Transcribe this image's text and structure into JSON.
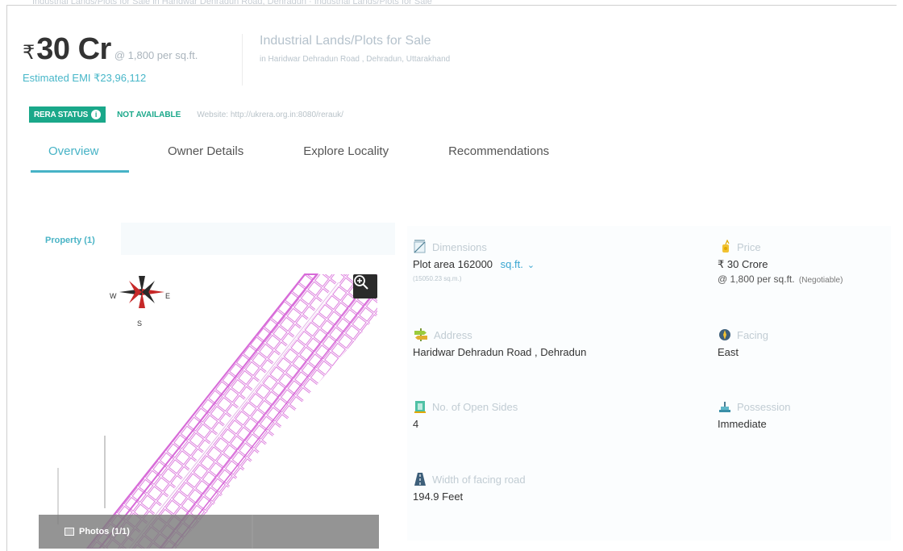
{
  "header": {
    "top_text": "Industrial Lands/Plots for Sale in Haridwar Dehradun Road, Dehradun · Industrial Lands/Plots for Sale",
    "price_symbol": "₹",
    "price": "30 Cr",
    "price_per_sqft": "@ 1,800 per sq.ft.",
    "emi": "Estimated EMI ₹23,96,112",
    "title": "Industrial Lands/Plots for Sale",
    "subtitle": "in Haridwar Dehradun Road , Dehradun, Uttarakhand"
  },
  "rera": {
    "badge": "RERA STATUS",
    "status": "NOT AVAILABLE",
    "website": "Website: http://ukrera.org.in:8080/rerauk/"
  },
  "tabs": [
    {
      "label": "Overview",
      "active": true
    },
    {
      "label": "Owner Details",
      "active": false
    },
    {
      "label": "Explore Locality",
      "active": false
    },
    {
      "label": "Recommendations",
      "active": false
    }
  ],
  "gallery": {
    "property_label": "Property (1)",
    "photos_label": "Photos (1/1)",
    "compass": {
      "w": "W",
      "e": "E",
      "s": "S"
    }
  },
  "details": {
    "dimensions": {
      "label": "Dimensions",
      "value": "Plot area 162000",
      "unit": "sq.ft.",
      "sub": "(15050.23 sq.m.)"
    },
    "price": {
      "label": "Price",
      "value": "₹ 30 Crore",
      "line2": "@ 1,800 per sq.ft.",
      "negotiable": "(Negotiable)"
    },
    "address": {
      "label": "Address",
      "value": "Haridwar Dehradun Road , Dehradun"
    },
    "facing": {
      "label": "Facing",
      "value": "East"
    },
    "open_sides": {
      "label": "No. of Open Sides",
      "value": "4"
    },
    "possession": {
      "label": "Possession",
      "value": "Immediate"
    },
    "road_width": {
      "label": "Width of facing road",
      "value": "194.9 Feet"
    }
  },
  "colors": {
    "accent": "#47b3c6",
    "rera_green": "#1aa88a",
    "plot_magenta": "#d76ad8"
  },
  "icons": [
    "info-icon",
    "zoom-in-icon",
    "compass-icon",
    "photo-icon",
    "dimensions-icon",
    "price-icon",
    "address-icon",
    "facing-icon",
    "open-sides-icon",
    "possession-icon",
    "road-icon",
    "chevron-down-icon"
  ]
}
